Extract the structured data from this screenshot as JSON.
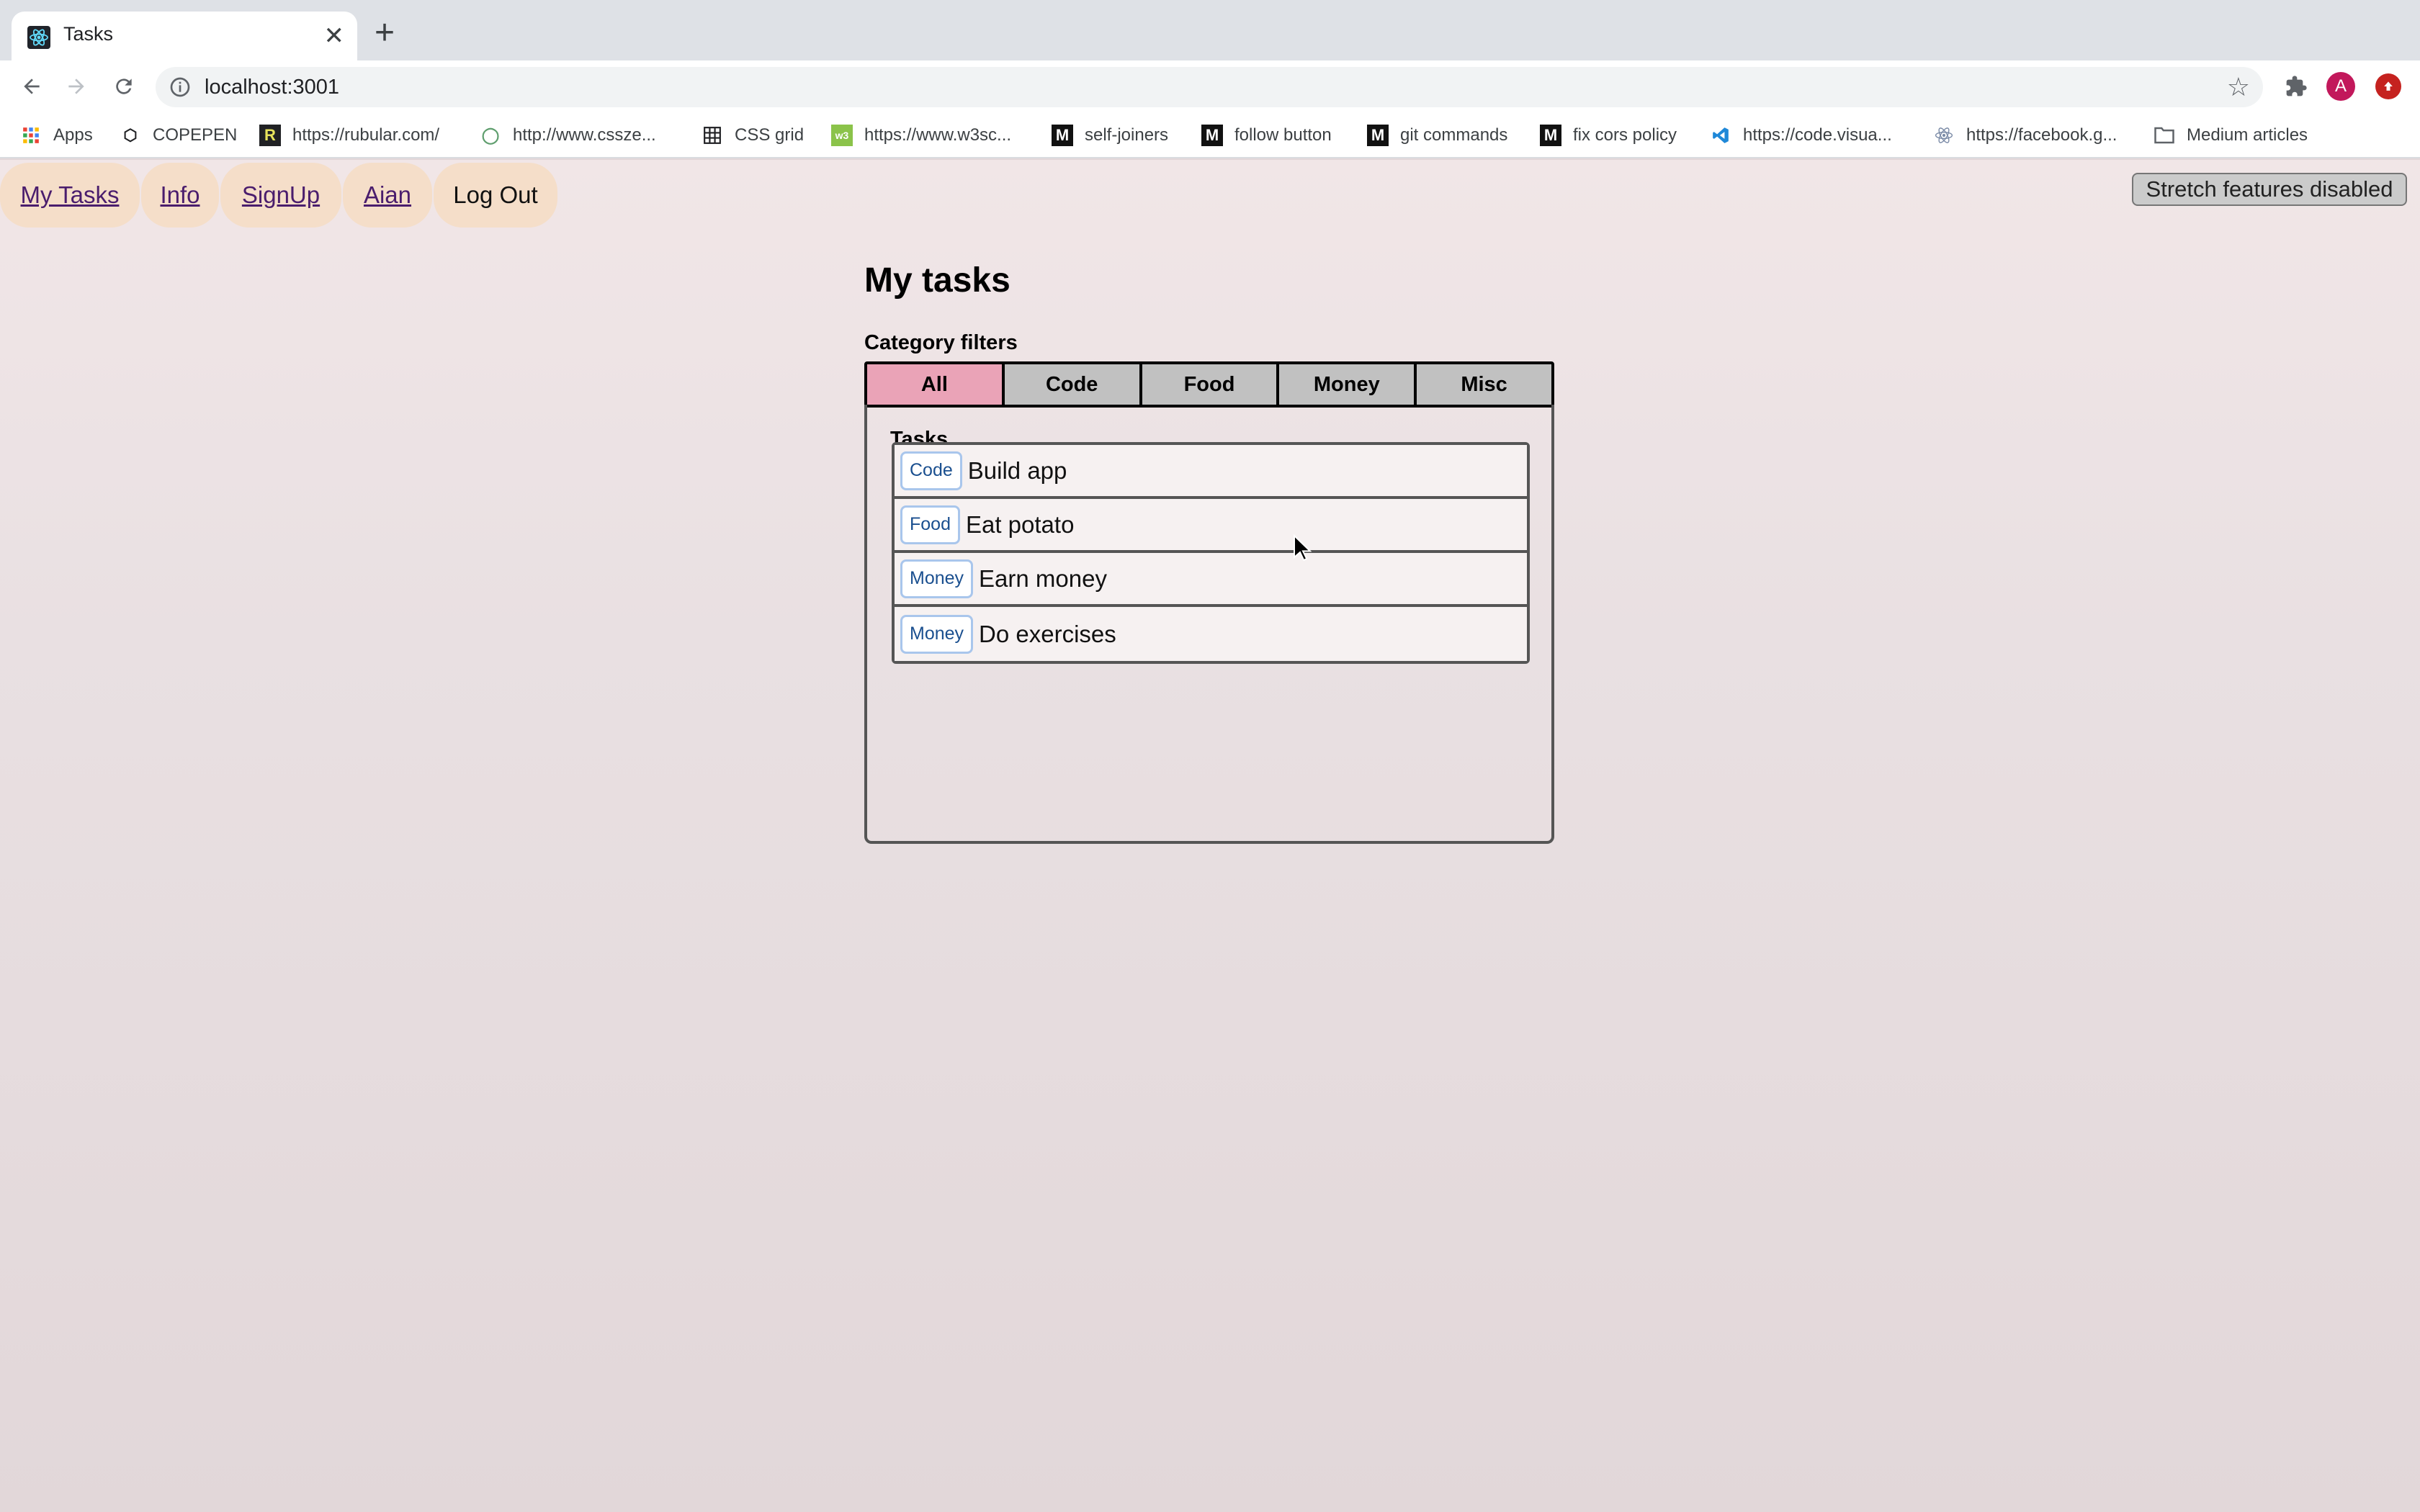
{
  "browser": {
    "tab_title": "Tasks",
    "tab_close": "✕",
    "new_tab": "+",
    "url": "localhost:3001",
    "avatar_letter": "A",
    "bookmarks": [
      {
        "label": "Apps",
        "icon": "apps-grid-icon"
      },
      {
        "label": "COPEPEN",
        "icon": "codepen-icon"
      },
      {
        "label": "https://rubular.com/",
        "icon": "rubular-icon"
      },
      {
        "label": "http://www.cssze...",
        "icon": "csszengarden-icon"
      },
      {
        "label": "CSS grid",
        "icon": "grid-icon"
      },
      {
        "label": "https://www.w3sc...",
        "icon": "w3schools-icon"
      },
      {
        "label": "self-joiners",
        "icon": "medium-icon"
      },
      {
        "label": "follow button",
        "icon": "medium-icon"
      },
      {
        "label": "git commands",
        "icon": "medium-icon"
      },
      {
        "label": "fix cors policy",
        "icon": "medium-icon"
      },
      {
        "label": "https://code.visua...",
        "icon": "vscode-icon"
      },
      {
        "label": "https://facebook.g...",
        "icon": "react-icon"
      },
      {
        "label": "Medium articles",
        "icon": "folder-icon"
      }
    ]
  },
  "nav": {
    "items": [
      {
        "label": "My Tasks"
      },
      {
        "label": "Info"
      },
      {
        "label": "SignUp"
      },
      {
        "label": "Aian"
      },
      {
        "label": "Log Out"
      }
    ],
    "stretch_button": "Stretch features disabled"
  },
  "main": {
    "title": "My tasks",
    "filters_label": "Category filters",
    "filters": [
      "All",
      "Code",
      "Food",
      "Money",
      "Misc"
    ],
    "active_filter": "All",
    "tasks_label": "Tasks",
    "tasks": [
      {
        "tag": "Code",
        "text": "Build app"
      },
      {
        "tag": "Food",
        "text": "Eat potato"
      },
      {
        "tag": "Money",
        "text": "Earn money"
      },
      {
        "tag": "Money",
        "text": "Do exercises"
      }
    ]
  },
  "colors": {
    "active_filter": "#eaa3b7",
    "filter": "#c1c1c1",
    "nav_pill": "#f5dec9",
    "tag_border": "#a9c6ec"
  }
}
